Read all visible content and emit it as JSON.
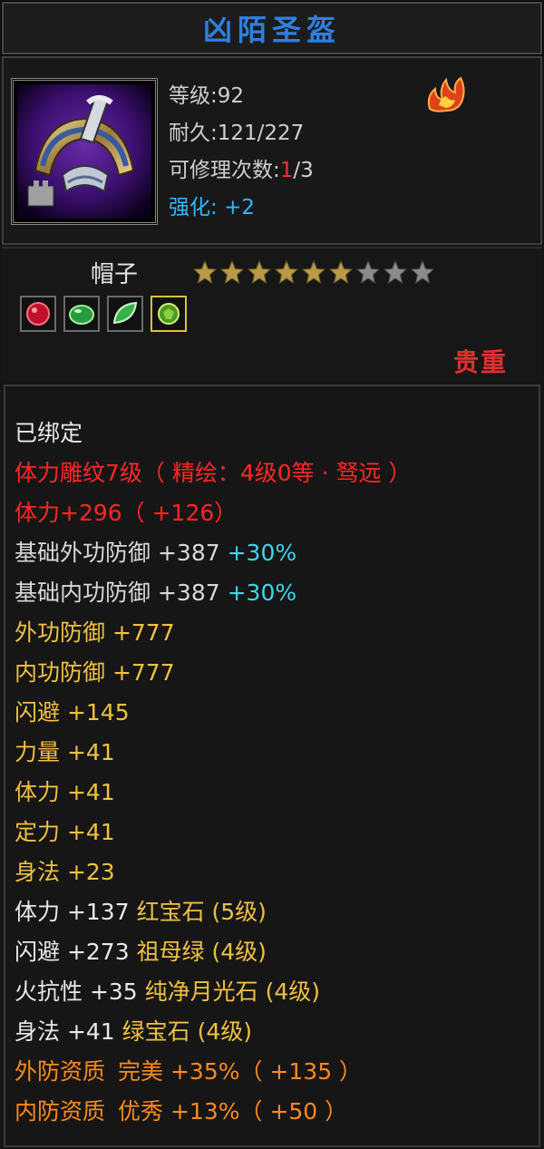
{
  "item": {
    "name": "凶陌圣盔",
    "level_label": "等级:92",
    "durability_label": "耐久:121/227",
    "repair_label_prefix": "可修理次数:",
    "repair_current": "1",
    "repair_total": "/3",
    "strength_label": "强化:",
    "strength_value": "+2",
    "type": "帽子",
    "stars_filled": 6,
    "stars_total": 9,
    "rarity": "贵重",
    "bound": "已绑定"
  },
  "colors": {
    "title": "#2f7fe0",
    "red": "#ff2626",
    "gold": "#f0c040",
    "cyan": "#3fd6e8",
    "orange": "#ff8a1a"
  },
  "gems": [
    {
      "name": "red-gem-icon",
      "selected": false
    },
    {
      "name": "green-jade-icon",
      "selected": false
    },
    {
      "name": "green-leaf-icon",
      "selected": false
    },
    {
      "name": "green-orb-icon",
      "selected": true
    }
  ],
  "attributes": {
    "engraving": "体力雕纹7级（ 精绘：4级0等 · 驽远 ）",
    "stamina_total": "体力+296（ +126）",
    "base_outer_def_name": "基础外功防御",
    "base_outer_def_value": "+387",
    "base_outer_def_bonus": "+30%",
    "base_inner_def_name": "基础内功防御",
    "base_inner_def_value": "+387",
    "base_inner_def_bonus": "+30%",
    "outer_def": "外功防御 +777",
    "inner_def": "内功防御 +777",
    "dodge": "闪避 +145",
    "power": "力量 +41",
    "stamina": "体力 +41",
    "focus": "定力 +41",
    "agility": "身法 +23",
    "gem1_stat": "体力 +137",
    "gem1_name": "红宝石 (5级)",
    "gem2_stat": "闪避 +273",
    "gem2_name": "祖母绿 (4级)",
    "gem3_stat": "火抗性 +35",
    "gem3_name": "纯净月光石 (4级)",
    "gem4_stat": "身法 +41",
    "gem4_name": "绿宝石 (4级)",
    "quality1_name": "外防资质",
    "quality1_grade": "完美",
    "quality1_value": "+35%（ +135 ）",
    "quality2_name": "内防资质",
    "quality2_grade": "优秀",
    "quality2_value": "+13%（ +50 ）"
  }
}
